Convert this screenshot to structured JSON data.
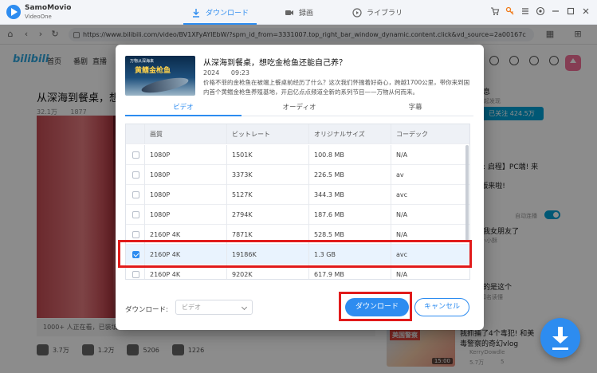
{
  "app": {
    "brand_line1": "SamoMovio",
    "brand_line2": "VideoOne",
    "tabs": [
      {
        "label": "ダウンロード",
        "active": true,
        "icon": "download-icon"
      },
      {
        "label": "録画",
        "active": false,
        "icon": "record-icon"
      },
      {
        "label": "ライブラリ",
        "active": false,
        "icon": "library-icon"
      }
    ],
    "window_tools": [
      "cart-icon",
      "key-icon",
      "menu-icon",
      "settings-icon",
      "minimize-icon",
      "maximize-icon",
      "close-icon"
    ]
  },
  "browser": {
    "url": "https://www.bilibili.com/video/BV1XFyAYIEbW/?spm_id_from=3331007.top_right_bar_window_dynamic.content.click&vd_source=2a00167c"
  },
  "bilibili": {
    "logo": "bilibili",
    "nav": [
      "首页",
      "番剧",
      "直播"
    ],
    "video_title": "从深海到餐桌，想",
    "views": "32.1万",
    "danmaku": "1877",
    "watching": "1000+ 人正在看，已装填 1475 条弹幕",
    "likes": "3.7万",
    "coins": "1.2万",
    "favorites": "5206",
    "shares": "1226",
    "sidebar": {
      "msg": "消息",
      "sub1": "一起发现",
      "follow": "已关注 424.5万",
      "rec1": "征: 启程】PC端! 来",
      "rec1b": "C版来啦!",
      "autoplay": "自动连播",
      "rec2": "苦我女朋友了",
      "rec2_author": "小小酥",
      "rec2_count": "5",
      "rec3": "会的是这个",
      "rec3_author": "知名读懂",
      "rec3_count": "5",
      "rec4_title": "我抓捕了4个毒犯! 和美",
      "rec4_title2": "毒警察的奇幻vlog",
      "rec4_author": "KerryDowdle",
      "rec4_views": "5.7万",
      "rec4_count": "5",
      "thumb_banner": "美国警察",
      "thumb_duration": "15:00"
    }
  },
  "dialog": {
    "thumbnail_caption": "万物从深海来",
    "thumbnail_title": "黄鳍金枪鱼",
    "title": "从深海到餐桌，想吃金枪鱼还能自己养？",
    "year": "2024",
    "time": "09:23",
    "description": "价格不菲的金枪鱼在被端上餐桌前经历了什么？这次我们怀揣着好奇心，跨越1700公里，带你来到国内首个黄鳍金枪鱼养殖基地，开启亿点点频道全新的系列节目——万物从何而来。",
    "tabs": [
      {
        "label": "ビデオ",
        "active": true
      },
      {
        "label": "オーディオ",
        "active": false
      },
      {
        "label": "字幕",
        "active": false
      }
    ],
    "columns": [
      "画質",
      "ビットレート",
      "オリジナルサイズ",
      "コーデック"
    ],
    "rows": [
      {
        "quality": "1080P",
        "bitrate": "1501K",
        "size": "100.8 MB",
        "codec": "N/A",
        "checked": false
      },
      {
        "quality": "1080P",
        "bitrate": "3373K",
        "size": "226.5 MB",
        "codec": "av",
        "checked": false
      },
      {
        "quality": "1080P",
        "bitrate": "5127K",
        "size": "344.3 MB",
        "codec": "avc",
        "checked": false
      },
      {
        "quality": "1080P",
        "bitrate": "2794K",
        "size": "187.6 MB",
        "codec": "N/A",
        "checked": false
      },
      {
        "quality": "2160P 4K",
        "bitrate": "7871K",
        "size": "528.5 MB",
        "codec": "N/A",
        "checked": false
      },
      {
        "quality": "2160P 4K",
        "bitrate": "19186K",
        "size": "1.3 GB",
        "codec": "avc",
        "checked": true
      },
      {
        "quality": "2160P 4K",
        "bitrate": "9202K",
        "size": "617.9 MB",
        "codec": "N/A",
        "checked": false
      }
    ],
    "download_type_label": "ダウンロード:",
    "download_type_value": "ビデオ",
    "download_button": "ダウンロード",
    "cancel_button": "キャンセル"
  },
  "colors": {
    "accent": "#2d8cf0",
    "highlight": "#e11b1b",
    "bili_blue": "#00a1d6"
  }
}
